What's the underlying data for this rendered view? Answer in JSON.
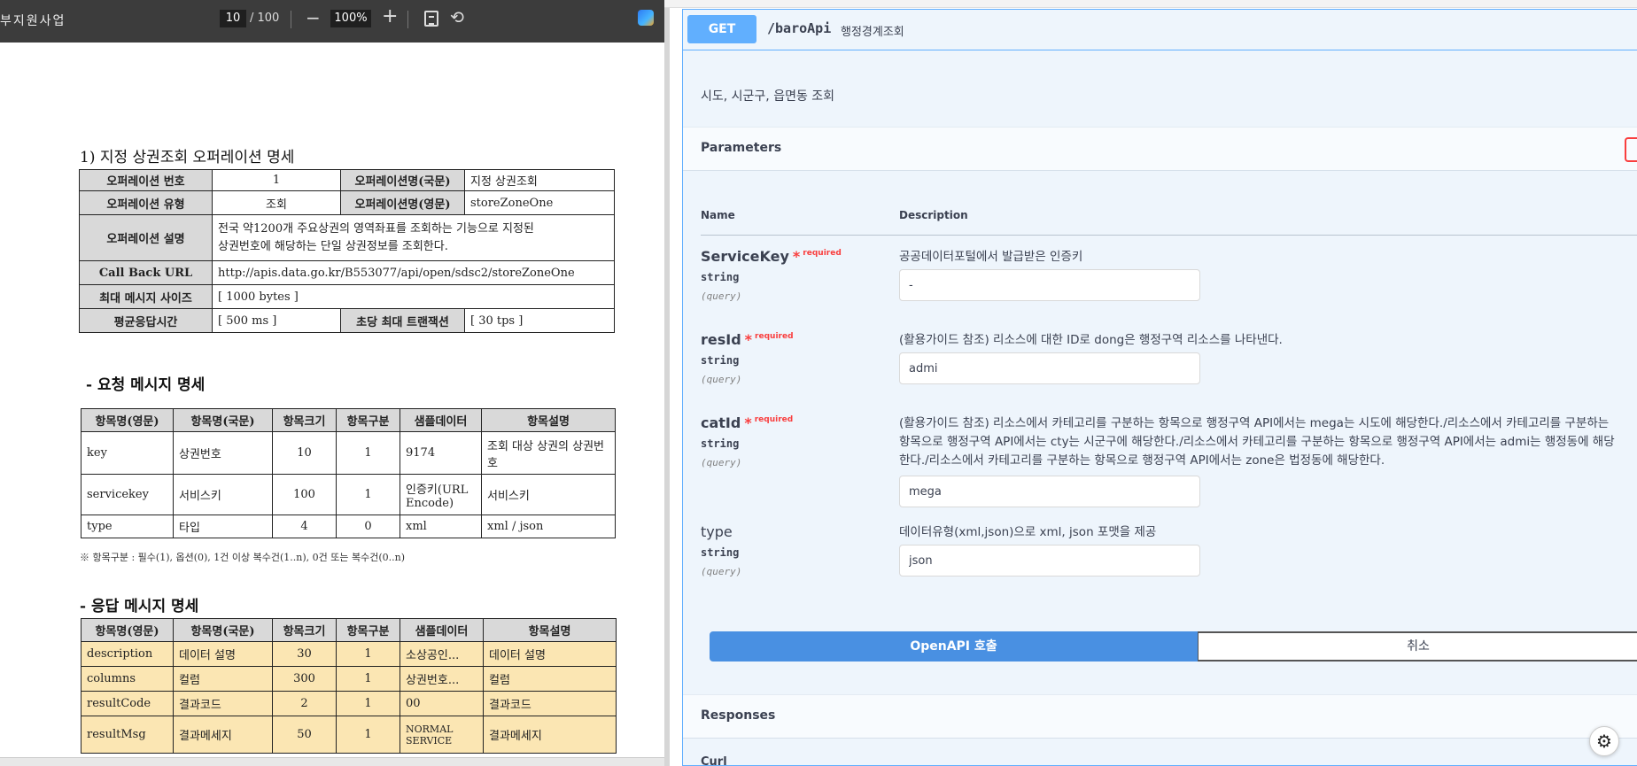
{
  "pdf_viewer": {
    "title": "부지원사업",
    "page_current": "10",
    "page_total": "/ 100",
    "zoom": "100%",
    "zoom_out_icon": "−",
    "zoom_in_icon": "+",
    "rotate_icon": "⟲"
  },
  "document": {
    "section_title": "1) 지정 상권조회 오퍼레이션 명세",
    "operation_table": {
      "op_number_label": "오퍼레이션 번호",
      "op_number": "1",
      "op_name_kr_label": "오퍼레이션명(국문)",
      "op_name_kr": "지정 상권조회",
      "op_type_label": "오퍼레이션 유형",
      "op_type": "조회",
      "op_name_en_label": "오퍼레이션명(영문)",
      "op_name_en": "storeZoneOne",
      "op_desc_label": "오퍼레이션 설명",
      "op_desc_line1": "전국 약1200개 주요상권의 영역좌표를 조회하는 기능으로 지정된",
      "op_desc_line2": "상권번호에 해당하는 단일 상권정보를 조회한다.",
      "callback_label": "Call Back URL",
      "callback_url": "http://apis.data.go.kr/B553077/api/open/sdsc2/storeZoneOne",
      "max_msg_label": "최대 메시지 사이즈",
      "max_msg": "[ 1000 bytes ]",
      "avg_resp_label": "평균응답시간",
      "avg_resp": "[ 500 ms ]",
      "max_tps_label": "초당 최대 트랜잭션",
      "max_tps": "[ 30 tps ]"
    },
    "request_title": "- 요청 메시지 명세",
    "columns": [
      "항목명(영문)",
      "항목명(국문)",
      "항목크기",
      "항목구분",
      "샘플데이터",
      "항목설명"
    ],
    "request_rows": [
      {
        "en": "key",
        "kr": "상권번호",
        "size": "10",
        "div": "1",
        "sample": "9174",
        "desc": "조회 대상 상권의 상권번호"
      },
      {
        "en": "servicekey",
        "kr": "서비스키",
        "size": "100",
        "div": "1",
        "sample": "인증키(URL Encode)",
        "desc": "서비스키"
      },
      {
        "en": "type",
        "kr": "타입",
        "size": "4",
        "div": "0",
        "sample": "xml",
        "desc": "xml / json"
      }
    ],
    "request_note": "※ 항목구분 : 필수(1), 옵션(0), 1건 이상 복수건(1..n), 0건 또는 복수건(0..n)",
    "response_title": "- 응답 메시지 명세",
    "response_rows": [
      {
        "en": "description",
        "kr": "데이터 설명",
        "size": "30",
        "div": "1",
        "sample": "소상공인...",
        "desc": "데이터 설명"
      },
      {
        "en": "columns",
        "kr": "컬럼",
        "size": "300",
        "div": "1",
        "sample": "상권번호...",
        "desc": "컬럼"
      },
      {
        "en": "resultCode",
        "kr": "결과코드",
        "size": "2",
        "div": "1",
        "sample": "00",
        "desc": "결과코드"
      },
      {
        "en": "resultMsg",
        "kr": "결과메세지",
        "size": "50",
        "div": "1",
        "sample": "NORMAL SERVICE",
        "desc": "결과메세지"
      }
    ]
  },
  "api": {
    "method": "GET",
    "path": "/baroApi",
    "summary": "행정경계조회",
    "description": "시도, 시군구, 읍면동 조회",
    "parameters_title": "Parameters",
    "col_name": "Name",
    "col_description": "Description",
    "required_label": "required",
    "required_star": "*",
    "params": [
      {
        "name": "ServiceKey",
        "type": "string",
        "in": "(query)",
        "desc": "공공데이터포털에서 발급받은 인증키",
        "value": "-"
      },
      {
        "name": "resId",
        "type": "string",
        "in": "(query)",
        "desc": "(활용가이드 참조) 리소스에 대한 ID로 dong은 행정구역 리소스를 나타낸다.",
        "value": "admi"
      },
      {
        "name": "catId",
        "type": "string",
        "in": "(query)",
        "desc_line1": "(활용가이드 참조) 리소스에서 카테고리를 구분하는 항목으로 행정구역 API에서는 mega는 시도에 해당한다./리소스에서 카테고리를 구분하는",
        "desc_line2": "항목으로 행정구역 API에서는 cty는 시군구에 해당한다./리소스에서 카테고리를 구분하는 항목으로 행정구역 API에서는 admi는 행정동에 해당",
        "desc_line3": "한다./리소스에서 카테고리를 구분하는 항목으로 행정구역 API에서는 zone은 법정동에 해당한다.",
        "value": "mega"
      },
      {
        "name": "type",
        "type": "string",
        "in": "(query)",
        "desc": "데이터유형(xml,json)으로 xml, json 포맷을 제공",
        "value": "json"
      }
    ],
    "execute_label": "OpenAPI 호출",
    "cancel_label": "취소",
    "responses_title": "Responses",
    "curl_title": "Curl"
  },
  "icons": {
    "assistant": "⚙"
  }
}
